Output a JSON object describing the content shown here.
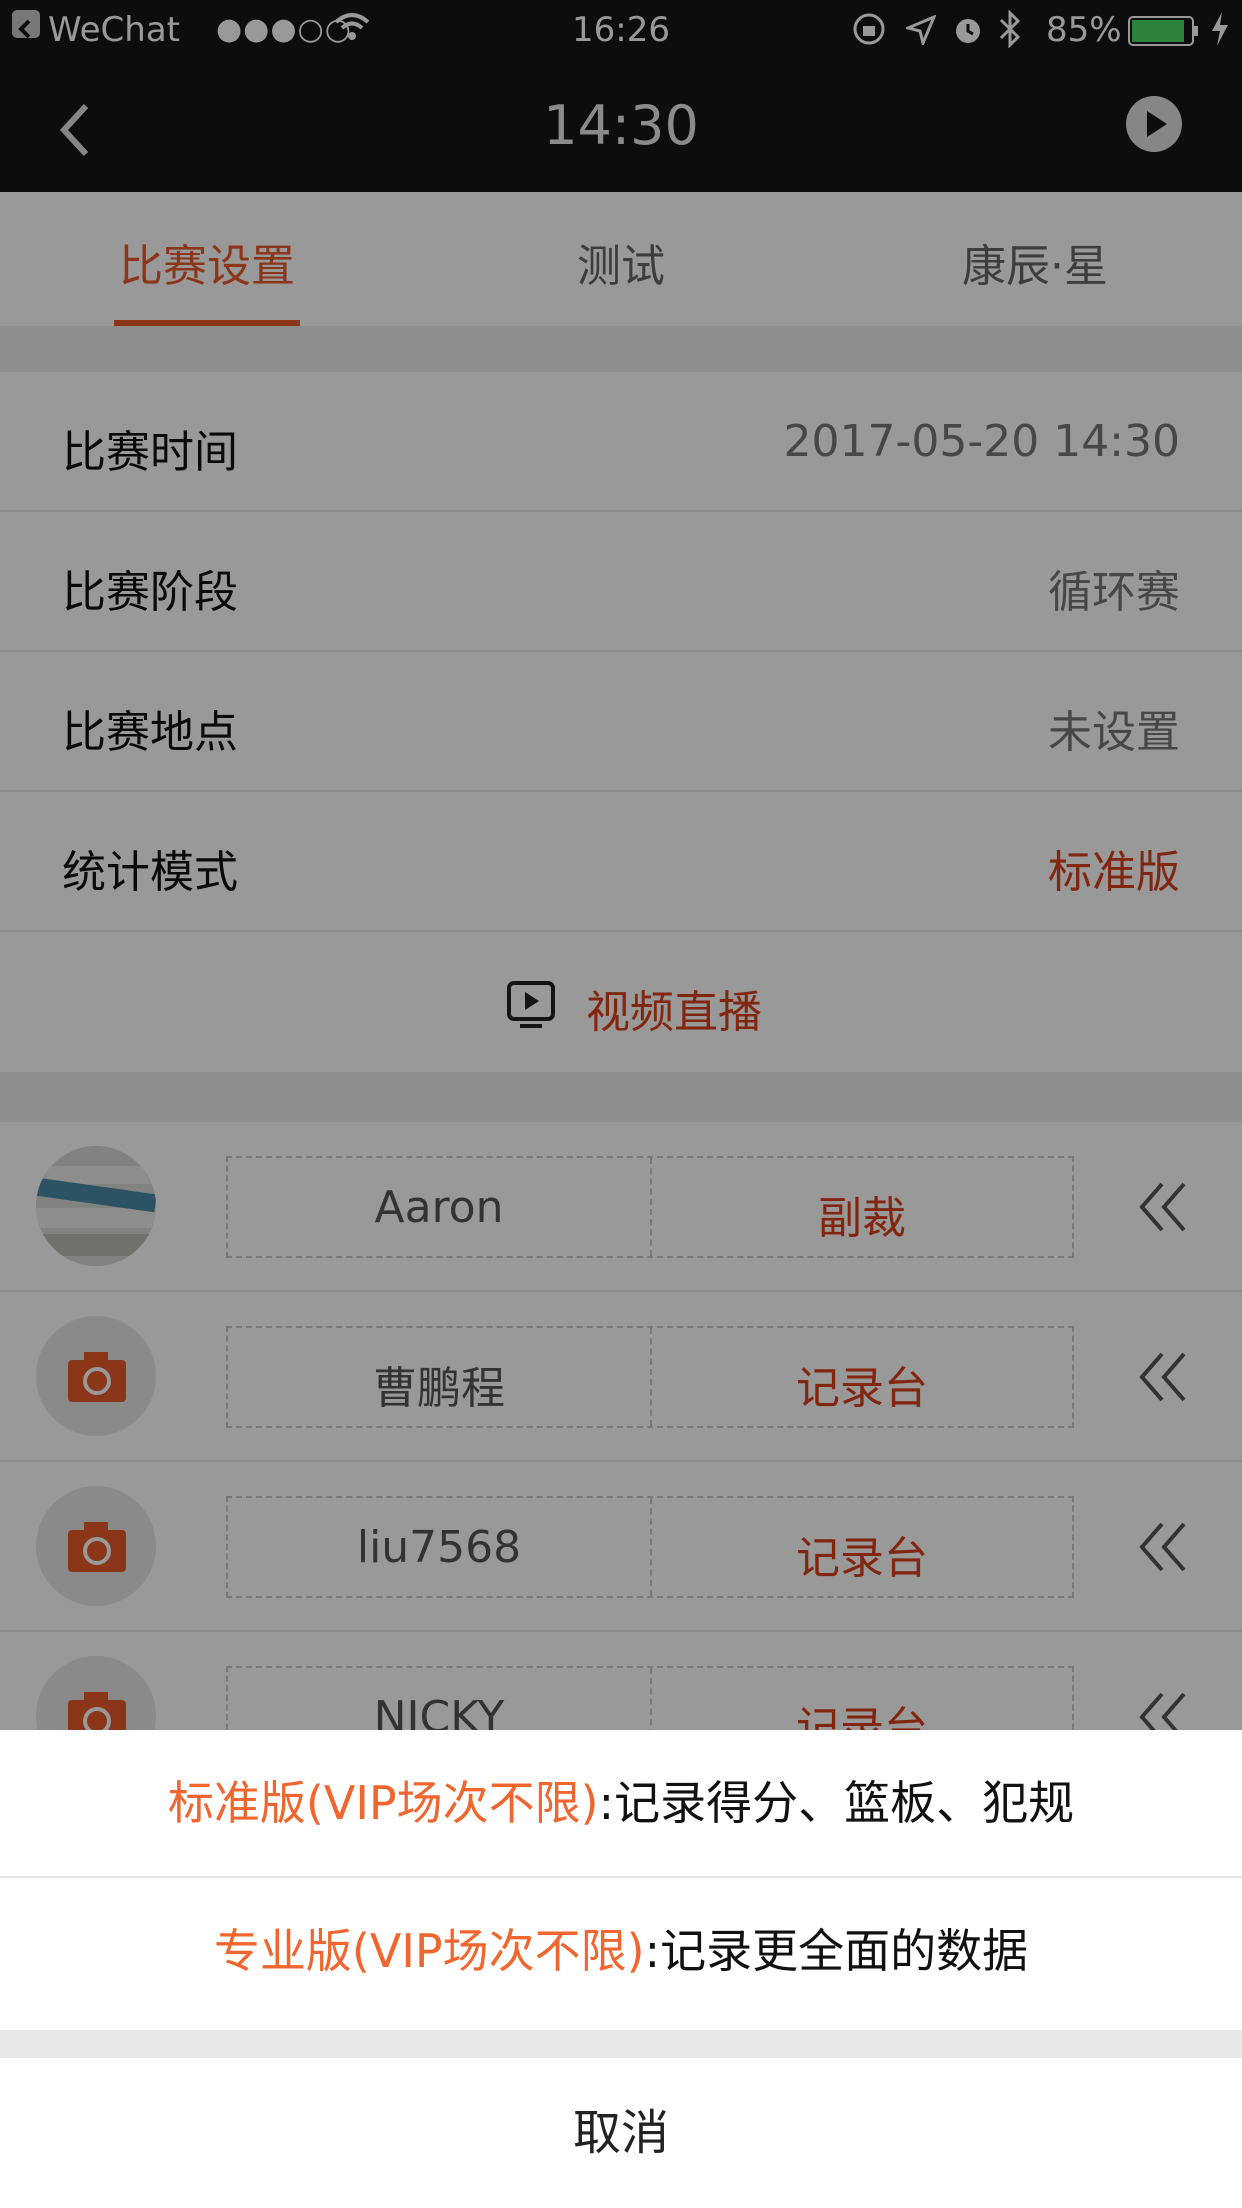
{
  "status_bar": {
    "back_app": "WeChat",
    "signal": "●●●○○",
    "time": "16:26",
    "battery": "85%"
  },
  "nav": {
    "title": "14:30"
  },
  "tabs": [
    {
      "label": "比赛设置",
      "active": true
    },
    {
      "label": "测试",
      "active": false
    },
    {
      "label": "康辰·星",
      "active": false
    }
  ],
  "settings": [
    {
      "label": "比赛时间",
      "value": "2017-05-20 14:30"
    },
    {
      "label": "比赛阶段",
      "value": "循环赛"
    },
    {
      "label": "比赛地点",
      "value": "未设置"
    },
    {
      "label": "统计模式",
      "value": "标准版"
    }
  ],
  "live": {
    "label": "视频直播"
  },
  "officials": [
    {
      "name": "Aaron",
      "role": "副裁"
    },
    {
      "name": "曹鹏程",
      "role": "记录台"
    },
    {
      "name": "liu7568",
      "role": "记录台"
    },
    {
      "name": "NICKY",
      "role": "记录台"
    }
  ],
  "sheet": {
    "options": [
      {
        "highlight": "标准版(VIP场次不限)",
        "desc": ":记录得分、篮板、犯规"
      },
      {
        "highlight": "专业版(VIP场次不限)",
        "desc": ":记录更全面的数据"
      }
    ],
    "cancel": "取消"
  },
  "colors": {
    "accent": "#e8592a",
    "sheet_highlight": "#f0662e"
  }
}
